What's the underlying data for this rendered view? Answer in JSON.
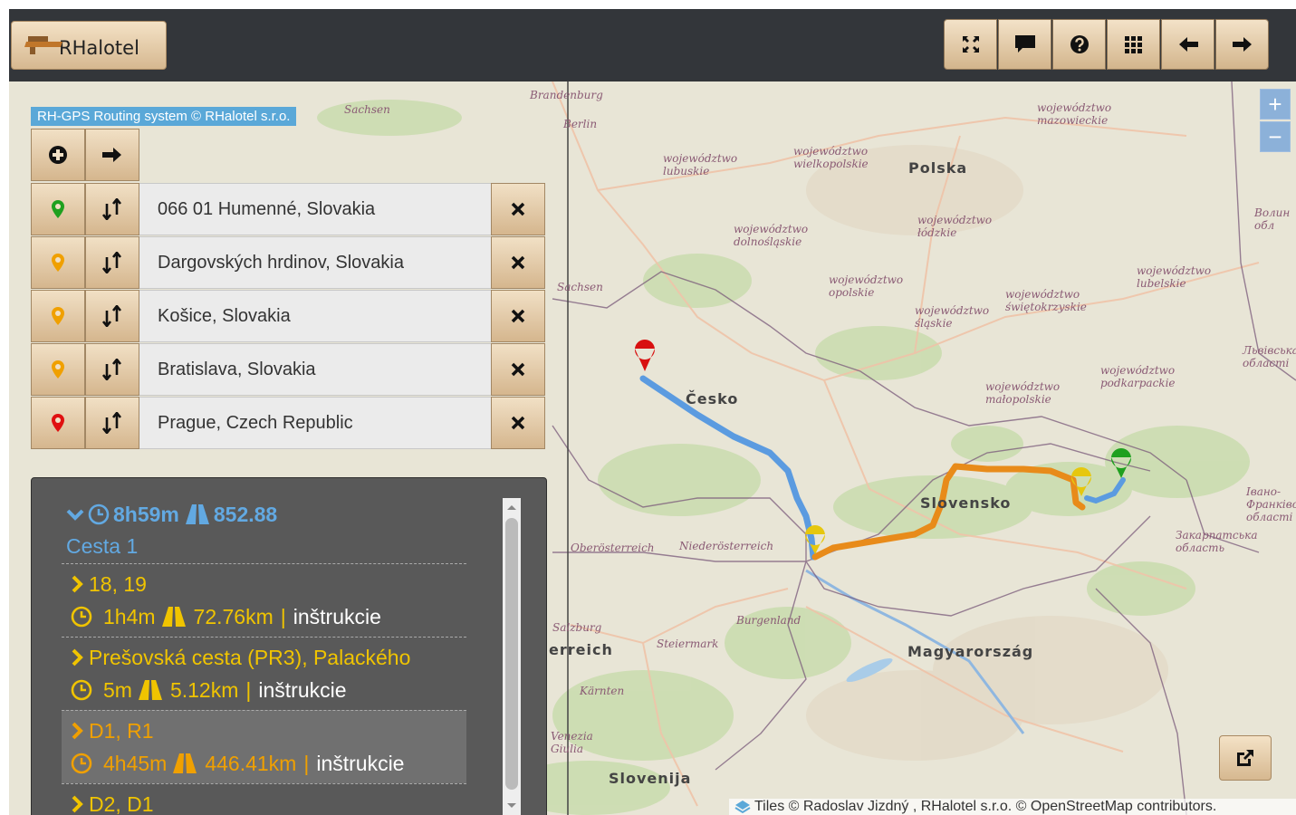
{
  "app": {
    "title": "RHalotel",
    "toolbar": [
      {
        "name": "fullscreen-icon"
      },
      {
        "name": "chat-icon"
      },
      {
        "name": "help-icon"
      },
      {
        "name": "grid-icon"
      },
      {
        "name": "arrow-left-icon"
      },
      {
        "name": "arrow-right-icon"
      }
    ]
  },
  "map": {
    "routing_attribution": "RH-GPS Routing system © RHalotel s.r.o.",
    "zoom_in": "+",
    "zoom_out": "−",
    "tile_attribution": "Tiles © Radoslav Jizdný , RHalotel s.r.o. © OpenStreetMap contributors.",
    "countries": [
      "Polska",
      "Česko",
      "Slovensko",
      "Magyarország",
      "Slovenija",
      "erreich"
    ],
    "labels": {
      "brandenburg": "Brandenburg",
      "berlin": "Berlin",
      "sachsen_top": "Sachsen",
      "sachsen": "Sachsen",
      "lubuskie": "województwo lubuskie",
      "wielkopolskie": "województwo wielkopolskie",
      "mazowieckie": "województwo mazowieckie",
      "dolnoslaskie": "województwo dolnośląskie",
      "lodzkie": "województwo łódzkie",
      "opolskie": "województwo opolskie",
      "slaskie": "województwo śląskie",
      "swietokrzyskie": "województwo świętokrzyskie",
      "lubelskie": "województwo lubelskie",
      "malopolskie": "województwo małopolskie",
      "podkarpackie": "województwo podkarpackie",
      "lviv": "Львівська області",
      "ivano": "Івано-Франківська області",
      "zakarpatska": "Закарпатська область",
      "oberosterreich": "Oberösterreich",
      "niederosterreich": "Niederösterreich",
      "burgenland": "Burgenland",
      "steiermark": "Steiermark",
      "salzburg": "Salzburg",
      "karnten": "Kärnten",
      "venezia": "Venezia Giulia",
      "volyn": "Волин обл"
    }
  },
  "waypoints": [
    {
      "label": "066 01 Humenné, Slovakia",
      "marker_color": "#1fa01f",
      "marker": "map-marker-icon"
    },
    {
      "label": "Dargovských hrdinov, Slovakia",
      "marker_color": "#f0a000",
      "marker": "map-marker-icon"
    },
    {
      "label": "Košice, Slovakia",
      "marker_color": "#f0a000",
      "marker": "map-marker-icon"
    },
    {
      "label": "Bratislava, Slovakia",
      "marker_color": "#f0a000",
      "marker": "map-marker-icon"
    },
    {
      "label": "Prague, Czech Republic",
      "marker_color": "#e01010",
      "marker": "map-marker-icon"
    }
  ],
  "route": {
    "duration": "8h59m",
    "distance": "852.88",
    "name": "Cesta 1",
    "segments": [
      {
        "roads": "18, 19",
        "duration": "1h4m",
        "distance": "72.76km",
        "sep": "|",
        "link": "inštrukcie",
        "selected": false
      },
      {
        "roads": "Prešovská cesta (PR3), Palackého",
        "duration": "5m",
        "distance": "5.12km",
        "sep": "|",
        "link": "inštrukcie",
        "selected": false
      },
      {
        "roads": "D1, R1",
        "duration": "4h45m",
        "distance": "446.41km",
        "sep": "|",
        "link": "inštrukcie",
        "selected": true
      },
      {
        "roads": "D2, D1",
        "duration": "",
        "distance": "",
        "sep": "",
        "link": "",
        "selected": false
      }
    ]
  },
  "colors": {
    "route_blue": "#5b9be0",
    "route_orange": "#e88b1a",
    "panel_text_blue": "#62a9e2",
    "segment_yellow": "#f0c400"
  }
}
